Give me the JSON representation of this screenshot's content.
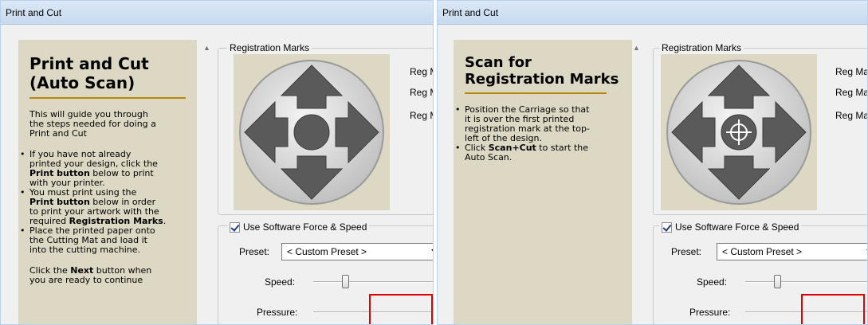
{
  "left": {
    "window_title": "Print and Cut",
    "guide": {
      "heading_line1": "Print and Cut",
      "heading_line2": "(Auto Scan)",
      "intro_l1": "This will guide you through",
      "intro_l2": "the steps needed for doing a",
      "intro_l3": "Print and Cut",
      "b1_l1": "If you have not already",
      "b1_l2": "printed your design, click the",
      "b1_l3_bold": "Print button",
      "b1_l3_rest": " below to print",
      "b1_l4": "with your printer.",
      "b2_l1": "You must print using the",
      "b2_l2_bold": "Print button",
      "b2_l2_rest": " below in order",
      "b2_l3": "to print your artwork with the",
      "b2_l4_pre": "required ",
      "b2_l4_bold": "Registration Marks",
      "b2_l4_post": ".",
      "b3_l1": "Place the printed paper onto",
      "b3_l2": "the Cutting Mat and load it",
      "b3_l3": "into the cutting machine.",
      "outro_l1_pre": "Click the ",
      "outro_l1_bold": "Next",
      "outro_l1_post": " button when",
      "outro_l2": "you are ready to continue"
    },
    "reg_group_label": "Registration Marks",
    "reg_items": [
      "Reg Mar",
      "Reg Mar",
      "Reg Mar"
    ],
    "force_label": "Use Software Force  & Speed",
    "preset_label": "Preset:",
    "preset_value": "< Custom Preset >",
    "speed_label": "Speed:",
    "pressure_label": "Pressure:"
  },
  "right": {
    "window_title": "Print and Cut",
    "guide": {
      "heading_line1": "Scan for",
      "heading_line2": "Registration Marks",
      "b1_l1": "Position the Carriage so that",
      "b1_l2": "it is over the first printed",
      "b1_l3": "registration mark at the top-",
      "b1_l4": "left of the design.",
      "b2_pre": "Click ",
      "b2_bold": "Scan+Cut",
      "b2_post": " to start the",
      "b2_l2": "Auto Scan."
    },
    "reg_group_label": "Registration Marks",
    "reg_items": [
      "Reg Mar",
      "Reg Mar",
      "Reg Mar"
    ],
    "force_label": "Use Software Force  & Speed",
    "preset_label": "Preset:",
    "preset_value": "< Custom Preset >",
    "speed_label": "Speed:",
    "pressure_label": "Pressure:"
  },
  "colors": {
    "guide_bg": "#ddd8c4",
    "accent_rule": "#b8860b",
    "highlight_box": "#e00000"
  }
}
